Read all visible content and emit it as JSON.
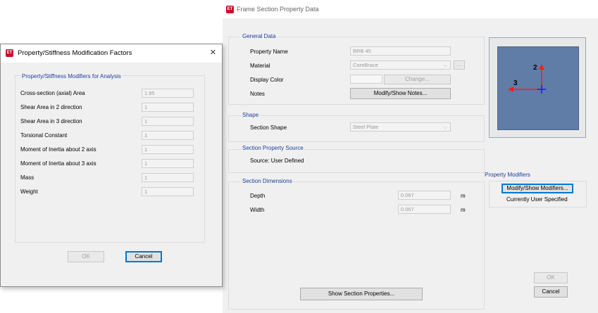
{
  "frame_dialog": {
    "title": "Frame Section Property Data",
    "app_icon": "ET",
    "general_data": {
      "group_title": "General Data",
      "property_name_label": "Property Name",
      "property_name_value": "BRB 45",
      "material_label": "Material",
      "material_value": "CoreBrace",
      "material_browse": "...",
      "display_color_label": "Display Color",
      "change_button": "Change...",
      "notes_label": "Notes",
      "notes_button": "Modify/Show Notes..."
    },
    "shape": {
      "group_title": "Shape",
      "section_shape_label": "Section Shape",
      "section_shape_value": "Steel Plate"
    },
    "source": {
      "group_title": "Section Property Source",
      "source_text": "Source:  User Defined"
    },
    "dimensions": {
      "group_title": "Section Dimensions",
      "depth_label": "Depth",
      "depth_value": "0.067",
      "depth_unit": "m",
      "width_label": "Width",
      "width_value": "0.067",
      "width_unit": "m"
    },
    "preview": {
      "axis2_label": "2",
      "axis3_label": "3",
      "background_color": "#5f7da6"
    },
    "modifiers": {
      "group_title": "Property Modifiers",
      "button": "Modify/Show Modifiers...",
      "status": "Currently User Specified"
    },
    "show_props_button": "Show Section Properties...",
    "ok_button": "OK",
    "cancel_button": "Cancel"
  },
  "mod_dialog": {
    "title": "Property/Stiffness Modification Factors",
    "app_icon": "ET",
    "close": "✕",
    "group_title": "Property/Stiffness Modifiers for Analysis",
    "rows": [
      {
        "label": "Cross-section (axial) Area",
        "value": "1.95"
      },
      {
        "label": "Shear Area in 2 direction",
        "value": "1"
      },
      {
        "label": "Shear Area in 3 direction",
        "value": "1"
      },
      {
        "label": "Torsional Constant",
        "value": "1"
      },
      {
        "label": "Moment of Inertia about 2 axis",
        "value": "1"
      },
      {
        "label": "Moment of Inertia about 3 axis",
        "value": "1"
      },
      {
        "label": "Mass",
        "value": "1"
      },
      {
        "label": "Weight",
        "value": "1"
      }
    ],
    "ok_button": "OK",
    "cancel_button": "Cancel"
  }
}
